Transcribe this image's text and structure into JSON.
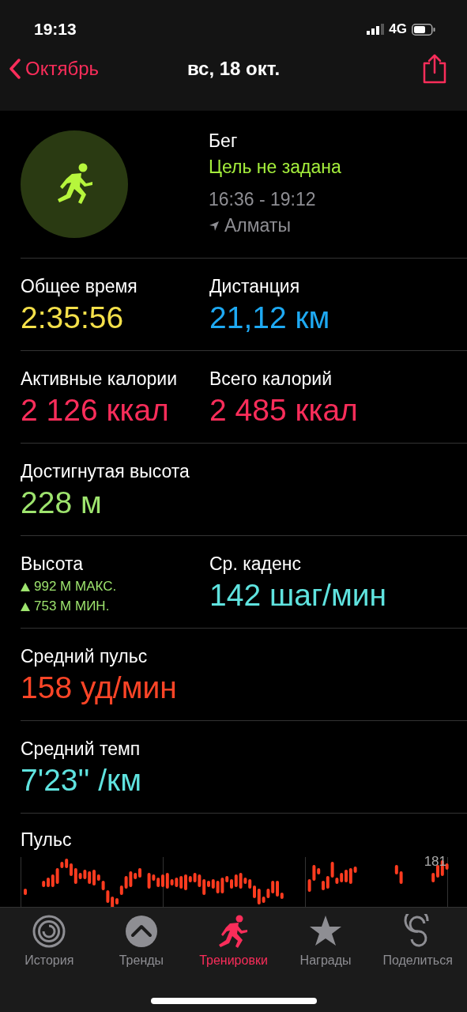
{
  "status_bar": {
    "time": "19:13",
    "network": "4G"
  },
  "nav": {
    "back": "Октябрь",
    "title": "вс, 18 окт."
  },
  "workout": {
    "name": "Бег",
    "goal": "Цель не задана",
    "time_range": "16:36 - 19:12",
    "location": "Алматы"
  },
  "metric_rows": [
    {
      "cells": [
        {
          "kind": "value",
          "label": "Общее время",
          "value": "2:35:56",
          "color": "#f4e04a"
        },
        {
          "kind": "value",
          "label": "Дистанция",
          "value": "21,12 км",
          "color": "#1ea9f2"
        }
      ]
    },
    {
      "cells": [
        {
          "kind": "value",
          "label": "Активные калории",
          "value": "2 126 ккал",
          "color": "#fa2d5a"
        },
        {
          "kind": "value",
          "label": "Всего калорий",
          "value": "2 485 ккал",
          "color": "#fa2d5a"
        }
      ]
    },
    {
      "cells": [
        {
          "kind": "value",
          "label": "Достигнутая высота",
          "value": "228 м",
          "color": "#9ee46e"
        }
      ]
    },
    {
      "cells": [
        {
          "kind": "range",
          "label": "Высота",
          "lines": [
            "992 М МАКС.",
            "753 М МИН."
          ],
          "color": "#9ee46e"
        },
        {
          "kind": "value",
          "label": "Ср. каденс",
          "value": "142 шаг/мин",
          "color": "#5fe3df"
        }
      ]
    },
    {
      "cells": [
        {
          "kind": "value",
          "label": "Средний пульс",
          "value": "158 уд/мин",
          "color": "#ff4527"
        }
      ]
    },
    {
      "cells": [
        {
          "kind": "value",
          "label": "Средний темп",
          "value": "7'23'' /км",
          "color": "#5fe3df"
        }
      ]
    }
  ],
  "heart_rate": {
    "title": "Пульс",
    "max_label": "181"
  },
  "tab_bar": [
    {
      "label": "История",
      "selected": false
    },
    {
      "label": "Тренды",
      "selected": false
    },
    {
      "label": "Тренировки",
      "selected": true
    },
    {
      "label": "Награды",
      "selected": false
    },
    {
      "label": "Поделиться",
      "selected": false
    }
  ]
}
